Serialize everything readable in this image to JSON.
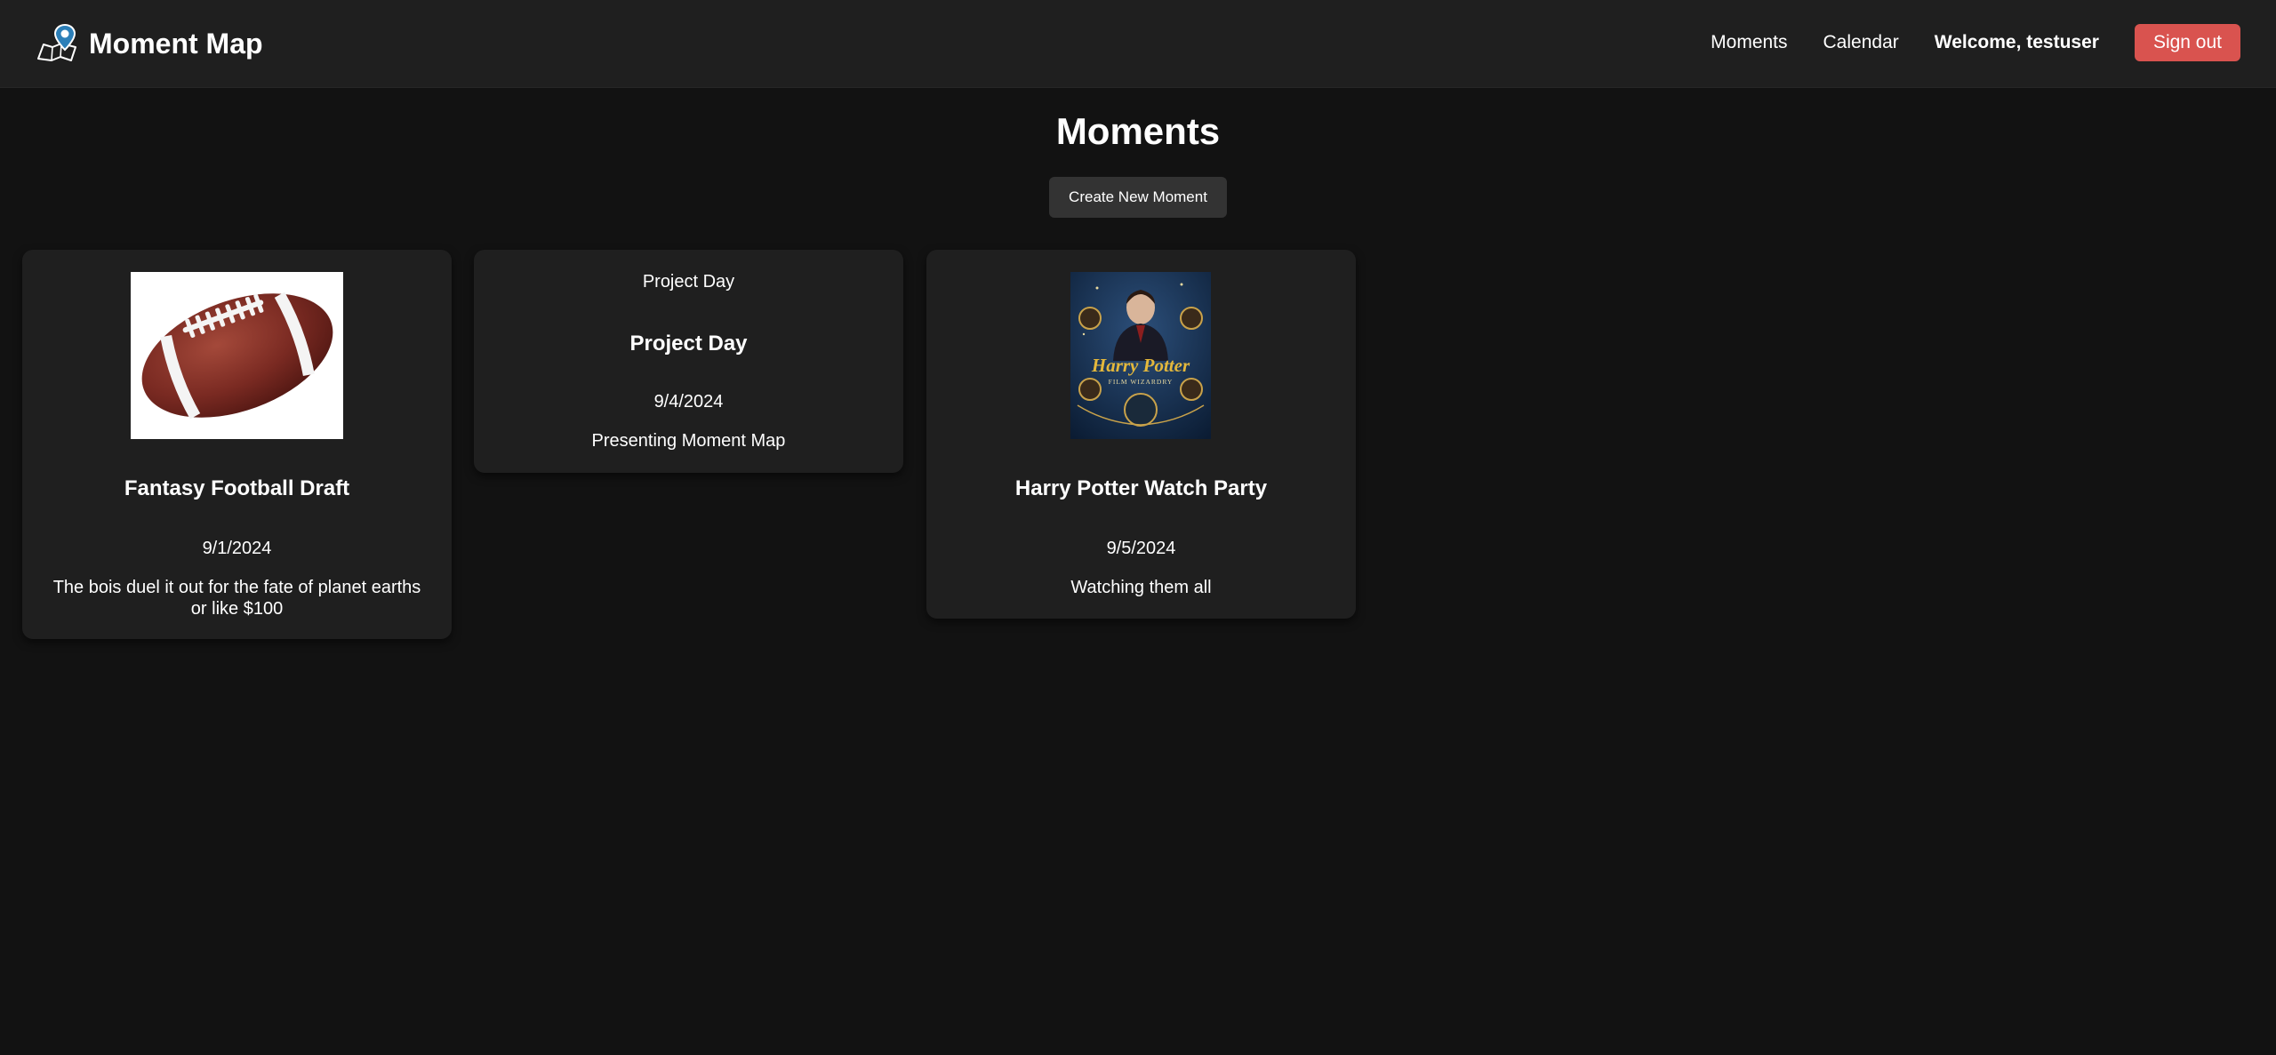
{
  "header": {
    "app_title": "Moment Map",
    "logo_icon": "map-pin-icon",
    "nav": {
      "moments_label": "Moments",
      "calendar_label": "Calendar"
    },
    "welcome_text": "Welcome, testuser",
    "sign_out_label": "Sign out"
  },
  "main": {
    "page_title": "Moments",
    "create_button_label": "Create New Moment",
    "cards": [
      {
        "image_alt": "football",
        "title": "Fantasy Football Draft",
        "date": "9/1/2024",
        "description": "The bois duel it out for the fate of planet earths or like $100"
      },
      {
        "image_fallback_text": "Project Day",
        "title": "Project Day",
        "date": "9/4/2024",
        "description": "Presenting Moment Map"
      },
      {
        "image_alt": "Harry Potter Film Wizardry",
        "image_cover_title": "Harry Potter",
        "image_cover_subtitle": "FILM WIZARDRY",
        "title": "Harry Potter Watch Party",
        "date": "9/5/2024",
        "description": "Watching them all"
      }
    ]
  },
  "colors": {
    "page_background": "#121212",
    "header_background": "#1f1f1f",
    "card_background": "#1f1f1f",
    "create_button": "#333333",
    "sign_out_button": "#d9534f"
  }
}
